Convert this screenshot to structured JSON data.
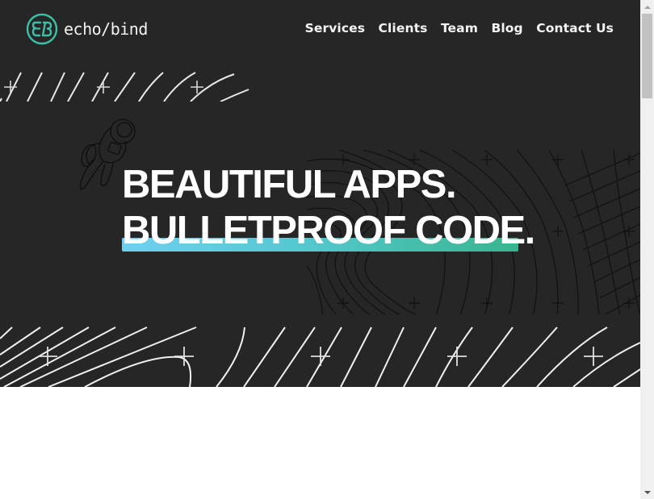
{
  "brand": {
    "name": "echo/bind",
    "logo_icon": "eb-monogram-circle-icon",
    "accent": "#3dbfa7"
  },
  "nav": {
    "items": [
      {
        "label": "Services"
      },
      {
        "label": "Clients"
      },
      {
        "label": "Team"
      },
      {
        "label": "Blog"
      },
      {
        "label": "Contact Us"
      }
    ]
  },
  "hero": {
    "headline_line1": "BEAUTIFUL APPS.",
    "headline_line2": "BULLETPROOF CODE.",
    "background_color": "#262626",
    "underline_gradient": [
      "#6fd0f0",
      "#38b58e"
    ],
    "illustration": "astronaut-icon"
  },
  "scrollbar": {
    "up_icon": "scroll-up-arrow-icon",
    "down_icon": "scroll-down-arrow-icon"
  }
}
